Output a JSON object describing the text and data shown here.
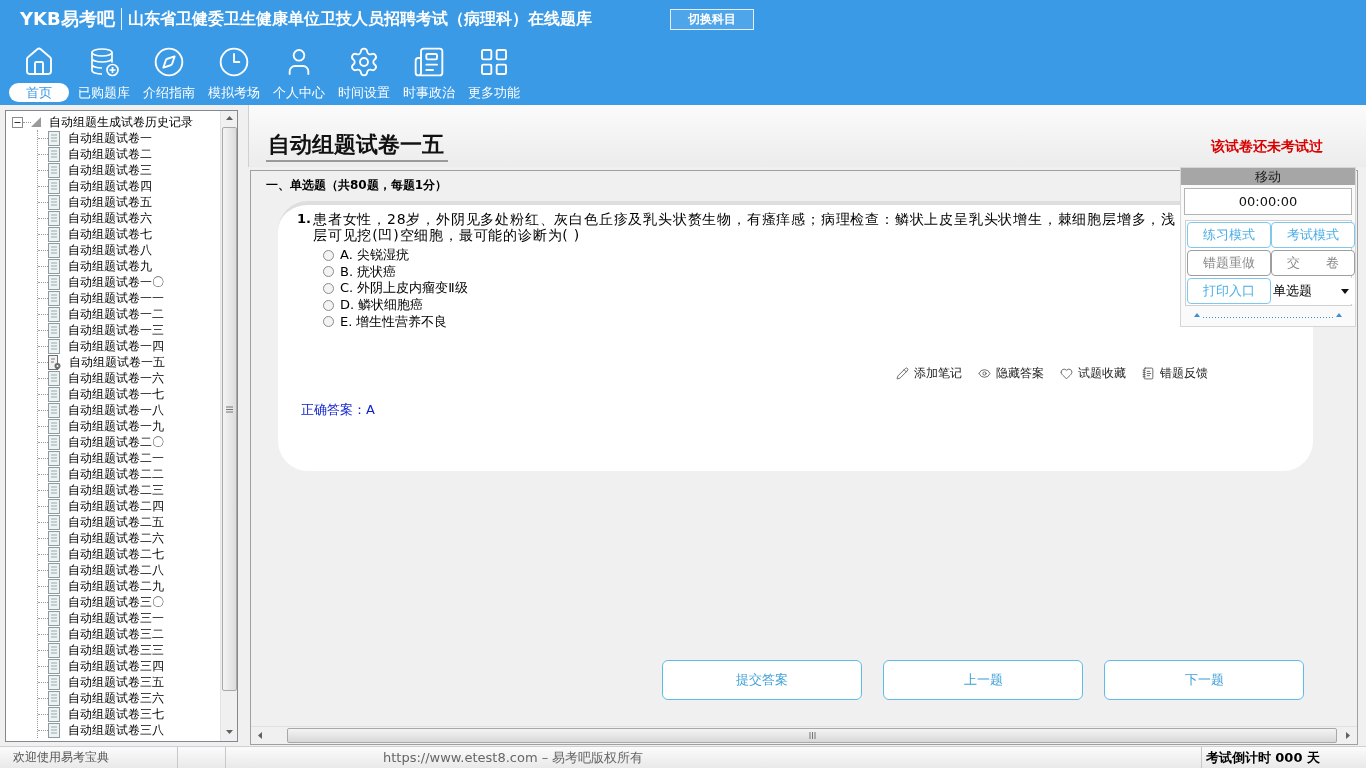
{
  "header": {
    "logo": "YKB易考吧",
    "title": "山东省卫健委卫生健康单位卫技人员招聘考试（病理科）在线题库",
    "switch_button": "切换科目"
  },
  "nav": [
    {
      "label": "首页",
      "selected": true
    },
    {
      "label": "已购题库",
      "selected": false
    },
    {
      "label": "介绍指南",
      "selected": false
    },
    {
      "label": "模拟考场",
      "selected": false
    },
    {
      "label": "个人中心",
      "selected": false
    },
    {
      "label": "时间设置",
      "selected": false
    },
    {
      "label": "时事政治",
      "selected": false
    },
    {
      "label": "更多功能",
      "selected": false
    }
  ],
  "tree": {
    "label": "自动组题生成试卷历史记录",
    "expanded": true,
    "children": [
      {
        "label": "自动组题试卷一",
        "selected": false
      },
      {
        "label": "自动组题试卷二",
        "selected": false
      },
      {
        "label": "自动组题试卷三",
        "selected": false
      },
      {
        "label": "自动组题试卷四",
        "selected": false
      },
      {
        "label": "自动组题试卷五",
        "selected": false
      },
      {
        "label": "自动组题试卷六",
        "selected": false
      },
      {
        "label": "自动组题试卷七",
        "selected": false
      },
      {
        "label": "自动组题试卷八",
        "selected": false
      },
      {
        "label": "自动组题试卷九",
        "selected": false
      },
      {
        "label": "自动组题试卷一〇",
        "selected": false
      },
      {
        "label": "自动组题试卷一一",
        "selected": false
      },
      {
        "label": "自动组题试卷一二",
        "selected": false
      },
      {
        "label": "自动组题试卷一三",
        "selected": false
      },
      {
        "label": "自动组题试卷一四",
        "selected": false
      },
      {
        "label": "自动组题试卷一五",
        "selected": true
      },
      {
        "label": "自动组题试卷一六",
        "selected": false
      },
      {
        "label": "自动组题试卷一七",
        "selected": false
      },
      {
        "label": "自动组题试卷一八",
        "selected": false
      },
      {
        "label": "自动组题试卷一九",
        "selected": false
      },
      {
        "label": "自动组题试卷二〇",
        "selected": false
      },
      {
        "label": "自动组题试卷二一",
        "selected": false
      },
      {
        "label": "自动组题试卷二二",
        "selected": false
      },
      {
        "label": "自动组题试卷二三",
        "selected": false
      },
      {
        "label": "自动组题试卷二四",
        "selected": false
      },
      {
        "label": "自动组题试卷二五",
        "selected": false
      },
      {
        "label": "自动组题试卷二六",
        "selected": false
      },
      {
        "label": "自动组题试卷二七",
        "selected": false
      },
      {
        "label": "自动组题试卷二八",
        "selected": false
      },
      {
        "label": "自动组题试卷二九",
        "selected": false
      },
      {
        "label": "自动组题试卷三〇",
        "selected": false
      },
      {
        "label": "自动组题试卷三一",
        "selected": false
      },
      {
        "label": "自动组题试卷三二",
        "selected": false
      },
      {
        "label": "自动组题试卷三三",
        "selected": false
      },
      {
        "label": "自动组题试卷三四",
        "selected": false
      },
      {
        "label": "自动组题试卷三五",
        "selected": false
      },
      {
        "label": "自动组题试卷三六",
        "selected": false
      },
      {
        "label": "自动组题试卷三七",
        "selected": false
      },
      {
        "label": "自动组题试卷三八",
        "selected": false
      }
    ]
  },
  "paper": {
    "title": "自动组题试卷一五",
    "status": "该试卷还未考试过"
  },
  "section": {
    "heading": "一、单选题（共80题，每题1分）"
  },
  "question": {
    "number": "1.",
    "text": "患者女性，28岁，外阴见多处粉红、灰白色丘疹及乳头状赘生物，有瘙痒感；病理检查：鳞状上皮呈乳头状增生，棘细胞层增多，浅层可见挖(凹)空细胞，最可能的诊断为( )",
    "options": [
      {
        "text": "A. 尖锐湿疣",
        "selected": false
      },
      {
        "text": "B. 疣状癌",
        "selected": false
      },
      {
        "text": "C. 外阴上皮内瘤变Ⅱ级",
        "selected": false
      },
      {
        "text": "D. 鳞状细胞癌",
        "selected": false
      },
      {
        "text": "E. 增生性营养不良",
        "selected": false
      }
    ],
    "actions": [
      "添加笔记",
      "隐藏答案",
      "试题收藏",
      "错题反馈"
    ],
    "answer": "正确答案：A"
  },
  "buttons": [
    "提交答案",
    "上一题",
    "下一题"
  ],
  "floating_panel": {
    "handle": "移动",
    "timer": "00:00:00",
    "buttons": [
      {
        "label": "练习模式",
        "disabled": false
      },
      {
        "label": "考试模式",
        "disabled": false
      },
      {
        "label": "错题重做",
        "disabled": true
      },
      {
        "label": "交　　卷",
        "disabled": true
      },
      {
        "label": "打印入口",
        "disabled": false
      }
    ],
    "question_type": "单选题"
  },
  "status_bar": {
    "welcome": "欢迎使用易考宝典",
    "copyright": "https://www.etest8.com – 易考吧版权所有",
    "countdown": "考试倒计时 000 天"
  }
}
